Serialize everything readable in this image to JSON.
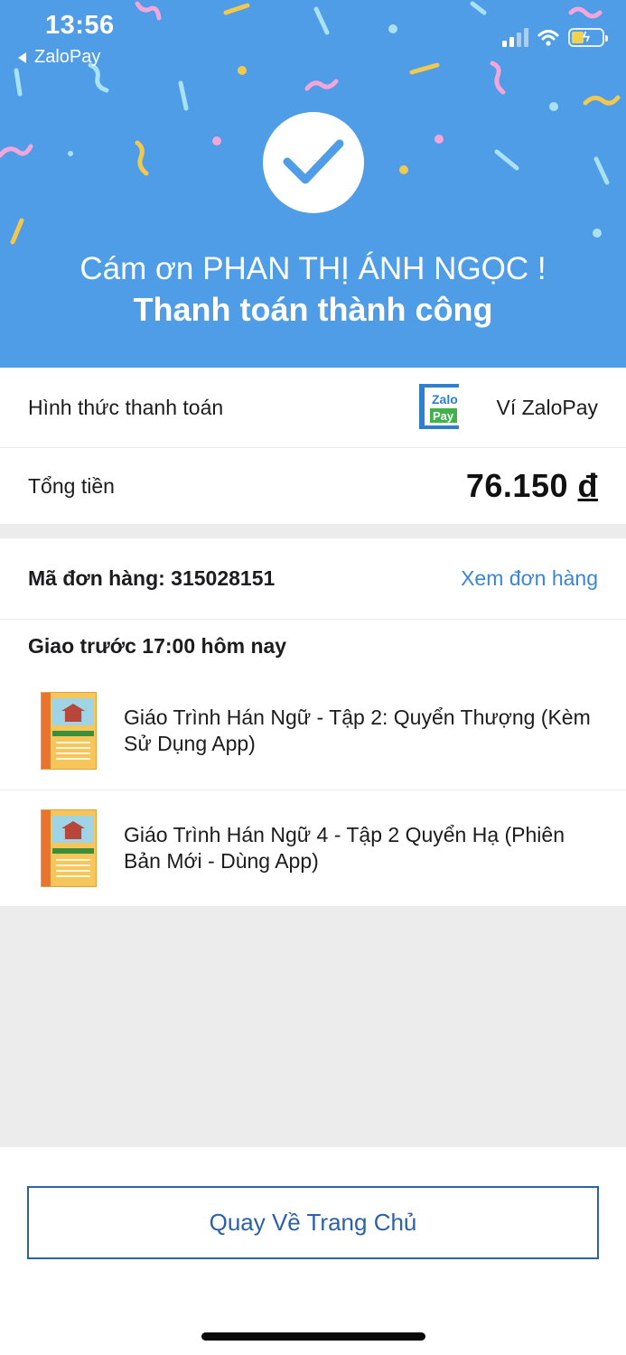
{
  "status_bar": {
    "time": "13:56",
    "back_app": "ZaloPay"
  },
  "hero": {
    "icon": "checkmark-icon",
    "thanks_text": "Cám ơn PHAN THỊ ÁNH NGỌC !",
    "success_text": "Thanh toán thành công",
    "background_color": "#4f9ce7"
  },
  "payment": {
    "method_label": "Hình thức thanh toán",
    "logo_text_top": "Zalo",
    "logo_text_bottom": "Pay",
    "method_value": "Ví ZaloPay",
    "total_label": "Tổng tiền",
    "total_amount": "76.150",
    "total_currency": "đ"
  },
  "order": {
    "code_label": "Mã đơn hàng: 315028151",
    "view_link": "Xem đơn hàng",
    "delivery_text": "Giao trước 17:00 hôm nay",
    "items": [
      {
        "title": "Giáo Trình Hán Ngữ - Tập 2: Quyển Thượng (Kèm Sử Dụng App)"
      },
      {
        "title": "Giáo Trình Hán Ngữ 4 - Tập 2 Quyển Hạ (Phiên Bản Mới - Dùng App)"
      }
    ]
  },
  "footer": {
    "home_button": "Quay Về Trang Chủ"
  },
  "colors": {
    "accent_link": "#3a86d6",
    "button_border": "#2c61a6"
  }
}
